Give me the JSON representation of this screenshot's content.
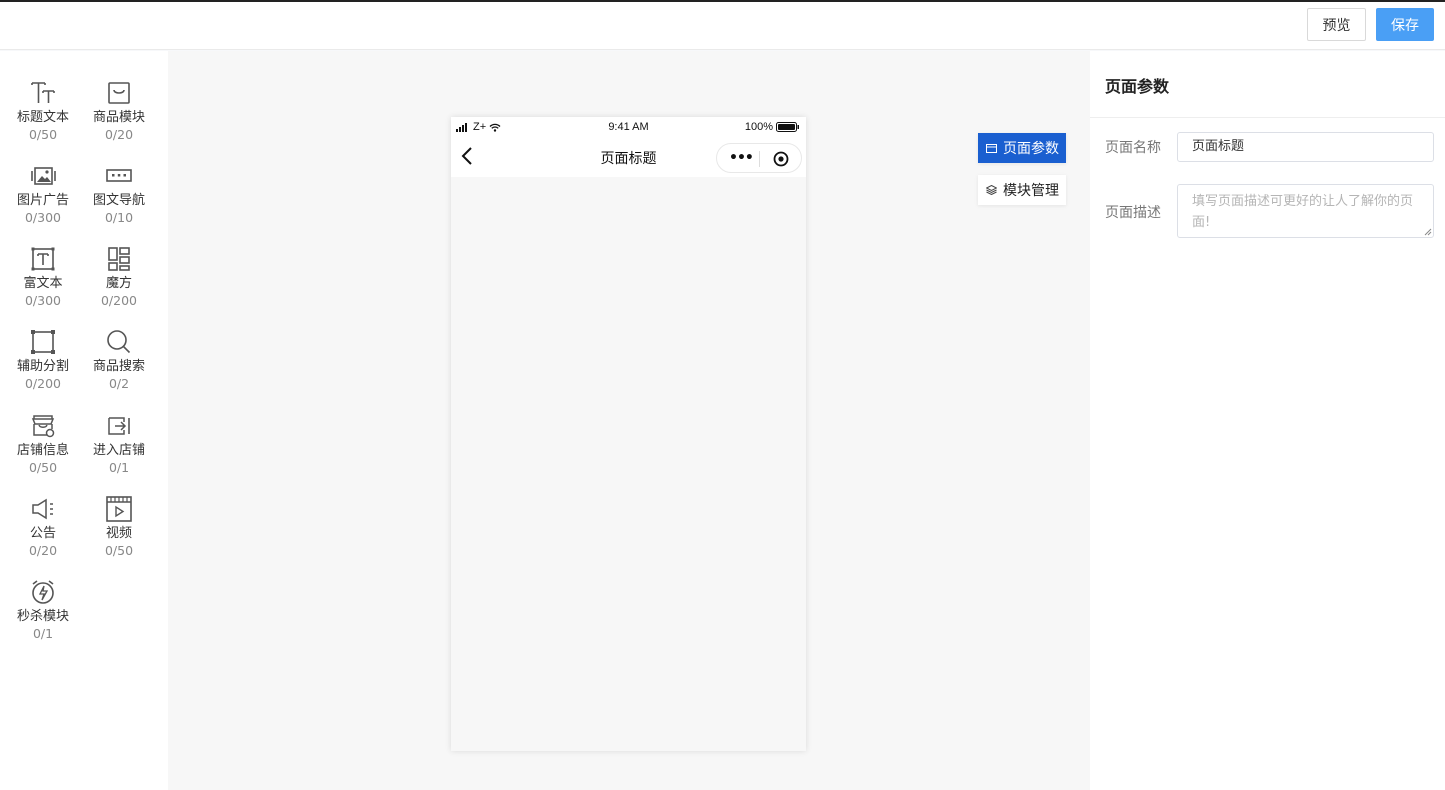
{
  "toolbar": {
    "preview_label": "预览",
    "save_label": "保存"
  },
  "components": [
    {
      "name": "标题文本",
      "count": "0/50",
      "icon": "title-text-icon"
    },
    {
      "name": "商品模块",
      "count": "0/20",
      "icon": "shopping-bag-icon"
    },
    {
      "name": "图片广告",
      "count": "0/300",
      "icon": "image-ad-icon"
    },
    {
      "name": "图文导航",
      "count": "0/10",
      "icon": "image-nav-icon"
    },
    {
      "name": "富文本",
      "count": "0/300",
      "icon": "rich-text-icon"
    },
    {
      "name": "魔方",
      "count": "0/200",
      "icon": "cube-layout-icon"
    },
    {
      "name": "辅助分割",
      "count": "0/200",
      "icon": "divider-icon"
    },
    {
      "name": "商品搜索",
      "count": "0/2",
      "icon": "search-icon"
    },
    {
      "name": "店铺信息",
      "count": "0/50",
      "icon": "store-info-icon"
    },
    {
      "name": "进入店铺",
      "count": "0/1",
      "icon": "enter-store-icon"
    },
    {
      "name": "公告",
      "count": "0/20",
      "icon": "megaphone-icon"
    },
    {
      "name": "视频",
      "count": "0/50",
      "icon": "video-icon"
    },
    {
      "name": "秒杀模块",
      "count": "0/1",
      "icon": "flash-sale-icon"
    }
  ],
  "phone": {
    "carrier": "Z+",
    "time": "9:41 AM",
    "battery": "100%",
    "page_title": "页面标题",
    "capsule_dots": "•••"
  },
  "side_tabs": {
    "page_params": "页面参数",
    "module_manage": "模块管理"
  },
  "right_panel": {
    "title": "页面参数",
    "name_label": "页面名称",
    "name_value": "页面标题",
    "desc_label": "页面描述",
    "desc_placeholder": "填写页面描述可更好的让人了解你的页面!"
  }
}
